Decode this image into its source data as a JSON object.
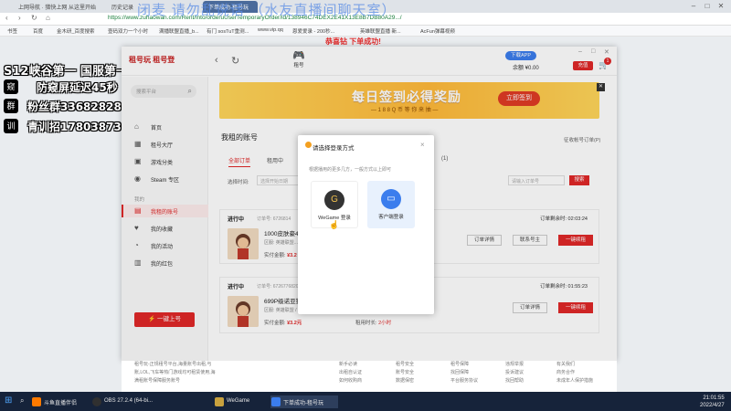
{
  "browser": {
    "tabs": [
      "上网导航 · 猎快上网 从这里开始",
      "历史记录",
      "下单成功-租号玩"
    ],
    "url": "https://www.zuhaowan.com/Rent/into/orderuUserTemporaryOrder/id/138946C74DEX2E41X13E8B7DB80A29.../",
    "bookmarks": [
      "书签",
      "百度",
      "金木研_百度搜索",
      "壹码双力一个小时",
      "满播联盟直播_b...",
      "有门 sosTuT重测...",
      "www.vip.qq",
      "恩爱爱录 - 200秒...",
      "英雄联盟直播 新...",
      "AcFun弹幕视频"
    ]
  },
  "watermark": "闭麦 请勿乱说话   （水友直播间聊天室）",
  "side_red_text": "恭喜钻 下单成功!",
  "overlay": {
    "line1": "S12峡谷第一 国服第一瓶克",
    "line2": "防窥屏延迟45秒",
    "line3": "粉丝群336828284",
    "line4": "青训招1780387301",
    "icon_texts": [
      "窥",
      "群",
      "训"
    ]
  },
  "app": {
    "logo": "租号玩 租号登",
    "logo2": "租号",
    "header_tab": "租号",
    "app_pill": "下载APP",
    "account": "余额 ¥0.00",
    "topup": "充值",
    "cart_count": "1",
    "sidebar": {
      "search_placeholder": "搜索平台",
      "items": [
        {
          "label": "首页",
          "icon": "home-icon"
        },
        {
          "label": "租号大厅",
          "icon": "hall-icon"
        },
        {
          "label": "游戏分类",
          "icon": "category-icon"
        },
        {
          "label": "Steam 专区",
          "icon": "steam-icon"
        }
      ],
      "section": "我的",
      "my_items": [
        {
          "label": "我租的账号",
          "icon": "account-icon",
          "active": true
        },
        {
          "label": "我的收藏",
          "icon": "heart-icon"
        },
        {
          "label": "我的活动",
          "icon": "activity-icon"
        },
        {
          "label": "我的红包",
          "icon": "redpacket-icon"
        }
      ],
      "rent_button": "一键上号"
    },
    "banner": {
      "title": "每日签到必得奖励",
      "subtitle": "— 1 8 8 Q 币 等 你 来 抽 —",
      "button": "立即签到"
    },
    "page_title": "我租的账号",
    "buyer_link": "征收帐号订单(P)",
    "filter_tabs": [
      "全部订单",
      "租用中"
    ],
    "filter_extra": "(1)",
    "filter_label": "选择时间:",
    "filter_date": "选择开始日期",
    "order_placeholder": "请输入订单号",
    "search_btn": "搜索",
    "orders": [
      {
        "status": "进行中",
        "order_id": "订单号: 6726814",
        "countdown": "订单剩余时: 02:03:24",
        "title": "1000皮肤豪4",
        "meta": "区服: 英雄联盟...",
        "price_label": "实付金额:",
        "price": "¥3.2",
        "time_label": "",
        "time": "",
        "btn_detail": "订单详情",
        "btn_extra": "联系号主",
        "btn_quick": "一键续租"
      },
      {
        "status": "进行中",
        "order_id": "订单号: 6726776820",
        "countdown": "订单剩余时: 01:55:23",
        "title": "699P级诺亚猫【天猫同购全部卡莎赛拉斯】五剑剑圣霸道星辰石",
        "meta": "区服: 英雄联盟 / 电信 / 艾欧尼亚      租用时间: 2022-04-27 20:52:16",
        "price_label": "实付金额:",
        "price": "¥3.2元",
        "time_label": "租用时长:",
        "time": "2小时",
        "btn_detail": "订单详情",
        "btn_extra": "",
        "btn_quick": "一键续租"
      }
    ],
    "modal": {
      "title": "请选择登录方式",
      "desc": "根据播用的更多几方，一般方式以上即可",
      "options": [
        {
          "label": "WeGame 登录",
          "icon": "G"
        },
        {
          "label": "客户端登录",
          "icon": "▭"
        }
      ]
    },
    "footer": {
      "col1": [
        "租号玩-正规租号平台,海量账号出租,与",
        "账,LOL,飞车等热门游戏均可租赁使用,海",
        "满租账号保障服务账号"
      ],
      "col2": [
        "新手必读",
        "出租自认证",
        "如何收购商"
      ],
      "col3": [
        "租号安全",
        "账号安全",
        "数据保密"
      ],
      "col4": [
        "租号保障",
        "找回保障",
        "平台服务协议"
      ],
      "col5": [
        "违规举报",
        "投诉建议",
        "找回帮助"
      ],
      "col6": [
        "有关我们",
        "商务合作",
        "未成年人保护措施"
      ]
    }
  },
  "taskbar": {
    "items": [
      "斗鱼直播伴侣",
      "OBS 27.2.4 (64-bi...",
      "WeGame",
      "下单成功-租号玩"
    ],
    "time": "21:01:55",
    "date": "2022/4/27"
  },
  "colors": {
    "accent": "#e02828",
    "taskbar": "#16233a",
    "banner": "#ffb93a"
  }
}
